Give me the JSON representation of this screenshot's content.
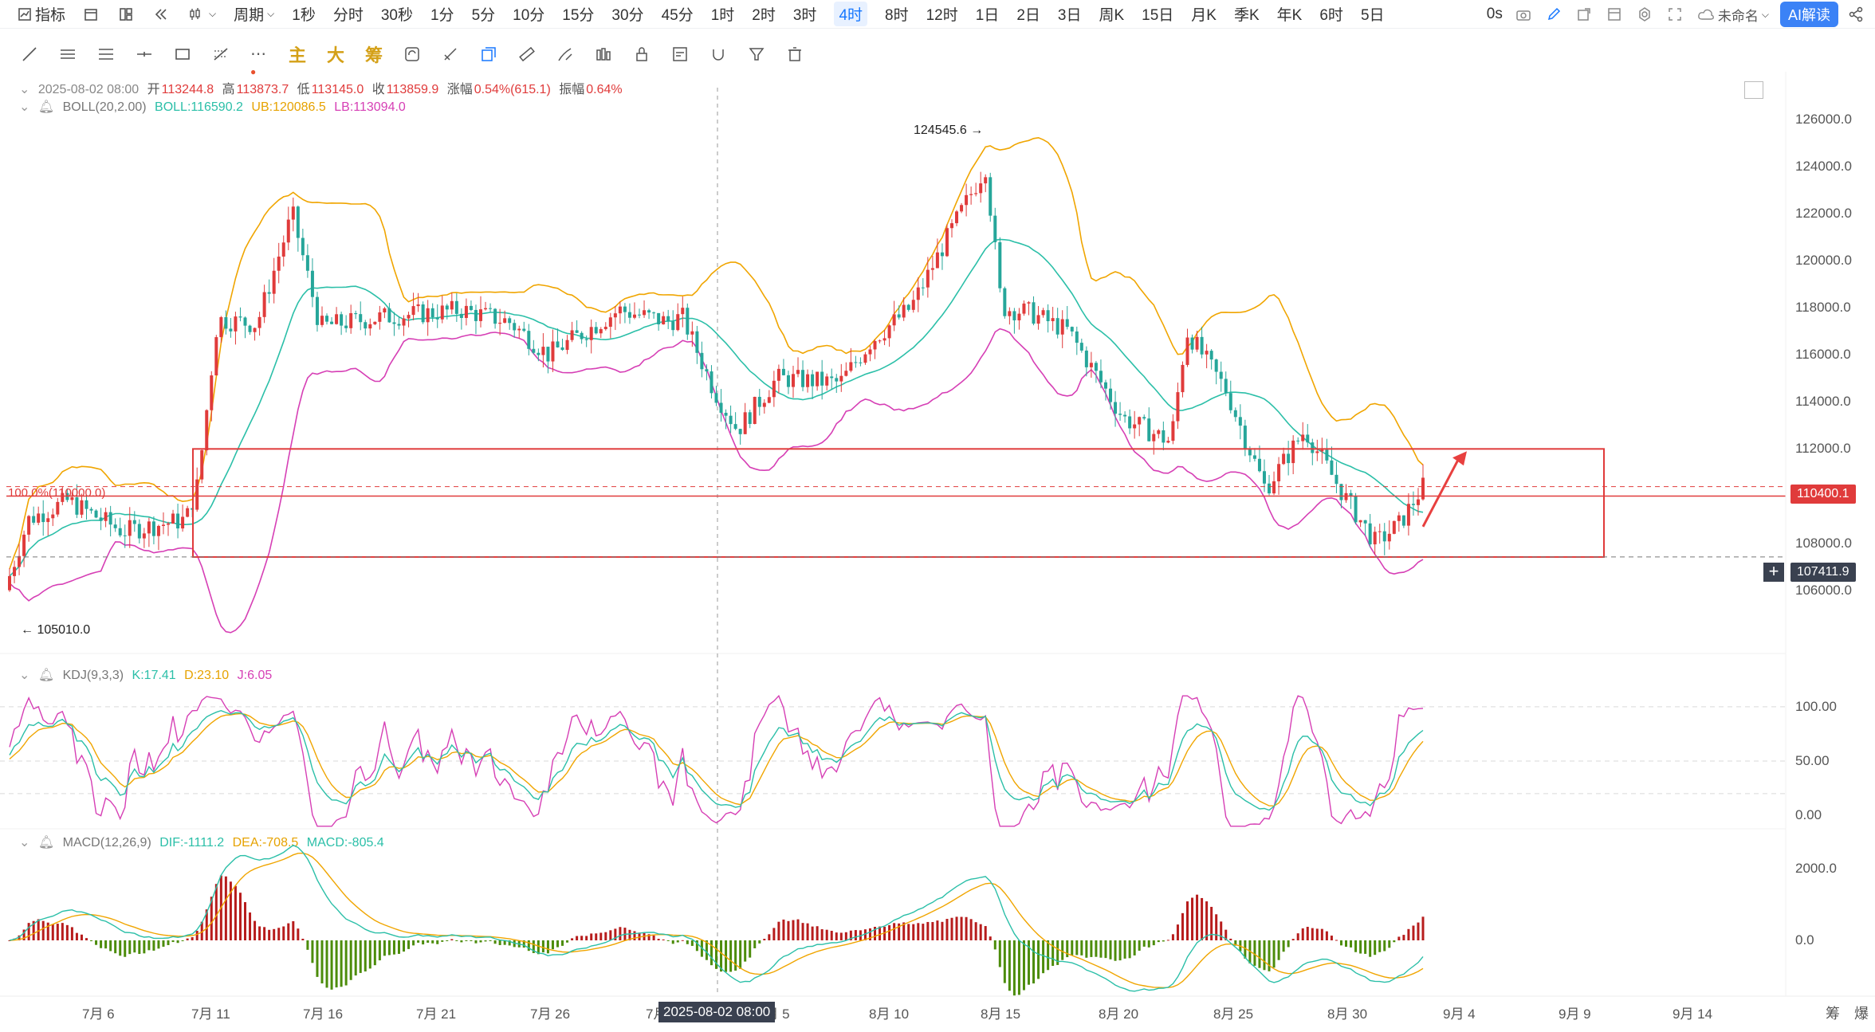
{
  "toolbar": {
    "indicator_label": "指标",
    "period_label": "周期",
    "timeframes": [
      "1秒",
      "分时",
      "30秒",
      "1分",
      "5分",
      "10分",
      "15分",
      "30分",
      "45分",
      "1时",
      "2时",
      "3时",
      "4时",
      "8时",
      "12时",
      "1日",
      "2日",
      "3日",
      "周K",
      "15日",
      "月K",
      "季K",
      "年K",
      "6时",
      "5日"
    ],
    "active_timeframe": "4时",
    "latency": "0s",
    "layout_name": "未命名",
    "ai_label": "AI解读"
  },
  "drawbar": {
    "main_label": "主",
    "big_label": "大",
    "chip_label": "筹"
  },
  "ohlc": {
    "date": "2025-08-02 08:00",
    "open_label": "开",
    "open": "113244.8",
    "high_label": "高",
    "high": "113873.7",
    "low_label": "低",
    "low": "113145.0",
    "close_label": "收",
    "close": "113859.9",
    "change_label": "涨幅",
    "change": "0.54%(615.1)",
    "amp_label": "振幅",
    "amp": "0.64%"
  },
  "boll": {
    "name": "BOLL(20,2.00)",
    "mid": "BOLL:116590.2",
    "ub": "UB:120086.5",
    "lb": "LB:113094.0"
  },
  "kdj": {
    "name": "KDJ(9,3,3)",
    "k": "K:17.41",
    "d": "D:23.10",
    "j": "J:6.05"
  },
  "macd": {
    "name": "MACD(12,26,9)",
    "dif": "DIF:-1111.2",
    "dea": "DEA:-708.5",
    "macd": "MACD:-805.4"
  },
  "price_axis": [
    "126000.0",
    "124000.0",
    "122000.0",
    "120000.0",
    "118000.0",
    "116000.0",
    "114000.0",
    "112000.0",
    "110000.0",
    "108000.0",
    "106000.0"
  ],
  "kdj_axis": [
    "100.00",
    "50.00",
    "0.00"
  ],
  "macd_axis": [
    "2000.0",
    "0.0"
  ],
  "time_axis": [
    "7月 6",
    "7月 11",
    "7月 16",
    "7月 21",
    "7月 26",
    "7月",
    "8月 5",
    "8月 10",
    "8月 15",
    "8月 20",
    "8月 25",
    "8月 30",
    "9月 4",
    "9月 9",
    "9月 14"
  ],
  "crosshair_time": "2025-08-02 08:00",
  "annotations": {
    "high_marker": "124545.6",
    "low_marker": "105010.0",
    "fib_label": "100.0%(110000.0)",
    "price_tag": "110400.1",
    "cursor_price": "107411.9"
  },
  "corner_labels": [
    "筹",
    "爆"
  ],
  "colors": {
    "up": "#e03b3b",
    "down": "#26a69a",
    "ub": "#f0a500",
    "lb": "#d63fb5",
    "mid": "#2bbfa8",
    "macd_up": "#b71c1c",
    "macd_down": "#4c8c0a"
  }
}
